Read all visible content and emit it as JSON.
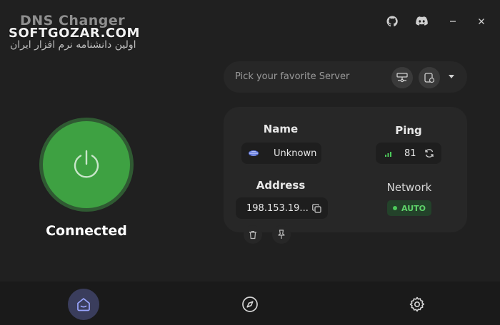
{
  "app": {
    "title": "DNS Changer",
    "watermark": "SOFTGOZAR.COM",
    "watermark_sub": "اولین دانشنامه نرم افزار ایران"
  },
  "server_picker": {
    "placeholder": "Pick your favorite Server"
  },
  "status": {
    "label": "Connected",
    "accent_color": "#3ea142"
  },
  "info": {
    "name_heading": "Name",
    "name_value": "Unknown",
    "ping_heading": "Ping",
    "ping_value": "81",
    "address_heading": "Address",
    "address_value": "198.153.19...",
    "network_heading": "Network",
    "network_value": "AUTO"
  },
  "nav": {
    "items": [
      {
        "name": "home",
        "icon": "home-icon",
        "active": true
      },
      {
        "name": "explore",
        "icon": "compass-icon",
        "active": false
      },
      {
        "name": "settings",
        "icon": "gear-icon",
        "active": false
      }
    ]
  },
  "window_controls": [
    "github-icon",
    "discord-icon",
    "minimize-icon",
    "close-icon"
  ]
}
